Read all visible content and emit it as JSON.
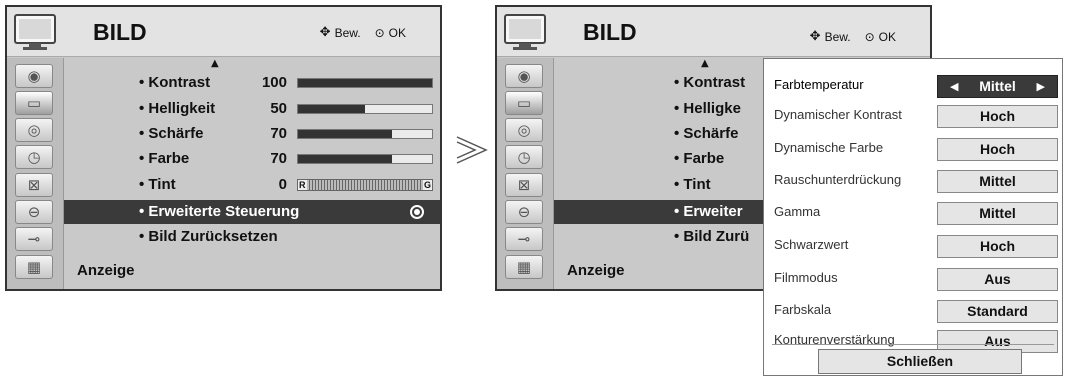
{
  "menu": {
    "title": "BILD",
    "nav_move": "Bew.",
    "nav_ok": "OK",
    "footer": "Anzeige",
    "items": [
      {
        "label": "• Kontrast",
        "value": "100",
        "level": 1.0
      },
      {
        "label": "• Helligkeit",
        "value": "50",
        "level": 0.5
      },
      {
        "label": "• Schärfe",
        "value": "70",
        "level": 0.7
      },
      {
        "label": "• Farbe",
        "value": "70",
        "level": 0.7
      },
      {
        "label": "• Tint",
        "value": "0",
        "tint_left": "R",
        "tint_right": "G"
      },
      {
        "label": "• Erweiterte Steuerung",
        "selected": true
      },
      {
        "label": "• Bild Zurücksetzen"
      }
    ],
    "panel2_items": [
      "• Kontrast",
      "• Helligke",
      "• Schärfe",
      "• Farbe",
      "• Tint",
      "• Erweiter",
      "• Bild Zurü"
    ]
  },
  "sidebar_icons": [
    "globe-icon",
    "tv-icon",
    "speaker-icon",
    "clock-icon",
    "lock-box-icon",
    "padlock-icon",
    "plug-icon",
    "clapper-icon"
  ],
  "advanced": {
    "rows": [
      {
        "label": "Farbtemperatur",
        "value": "Mittel",
        "selected": true
      },
      {
        "label": "Dynamischer Kontrast",
        "value": "Hoch"
      },
      {
        "label": "Dynamische Farbe",
        "value": "Hoch"
      },
      {
        "label": "Rauschunterdrückung",
        "value": "Mittel"
      },
      {
        "label": "Gamma",
        "value": "Mittel"
      },
      {
        "label": "Schwarzwert",
        "value": "Hoch"
      },
      {
        "label": "Filmmodus",
        "value": "Aus"
      },
      {
        "label": "Farbskala",
        "value": "Standard"
      },
      {
        "label": "Konturenverstärkung",
        "value": "Aus"
      }
    ],
    "close_label": "Schließen"
  }
}
